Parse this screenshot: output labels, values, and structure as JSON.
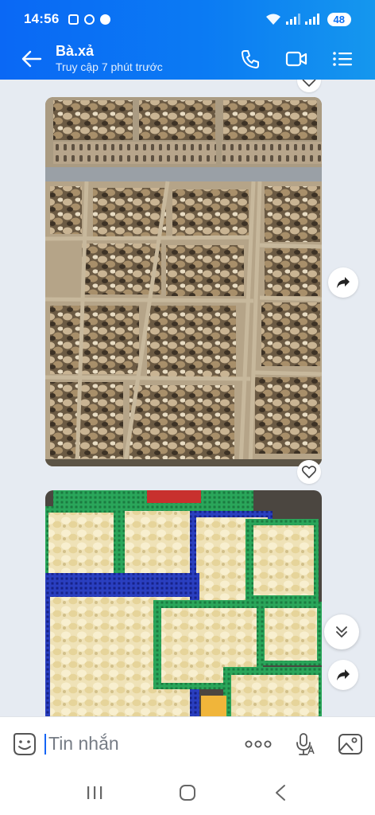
{
  "status_bar": {
    "time": "14:56",
    "battery": "48",
    "left_icons": [
      "screenshot-icon",
      "chrome-icon",
      "chat-bubble-icon"
    ],
    "right_icons": [
      "wifi-icon",
      "signal-icon",
      "signal-icon"
    ]
  },
  "header": {
    "contact_name": "Bà.xả",
    "last_seen": "Truy cập 7 phút trước",
    "actions": [
      "phone-icon",
      "video-call-icon",
      "menu-icon"
    ]
  },
  "messages": [
    {
      "type": "photo",
      "subject": "ducklings in cardboard crates"
    },
    {
      "type": "photo",
      "subject": "chicks in plastic baskets"
    }
  ],
  "composer": {
    "placeholder": "Tin nhắn",
    "actions": [
      "more-icon",
      "voice-icon",
      "image-icon"
    ]
  },
  "colors": {
    "header_gradient_start": "#0a68f5",
    "header_gradient_end": "#1597ee",
    "chat_background": "#e6ebf2",
    "caret": "#1565f5"
  }
}
